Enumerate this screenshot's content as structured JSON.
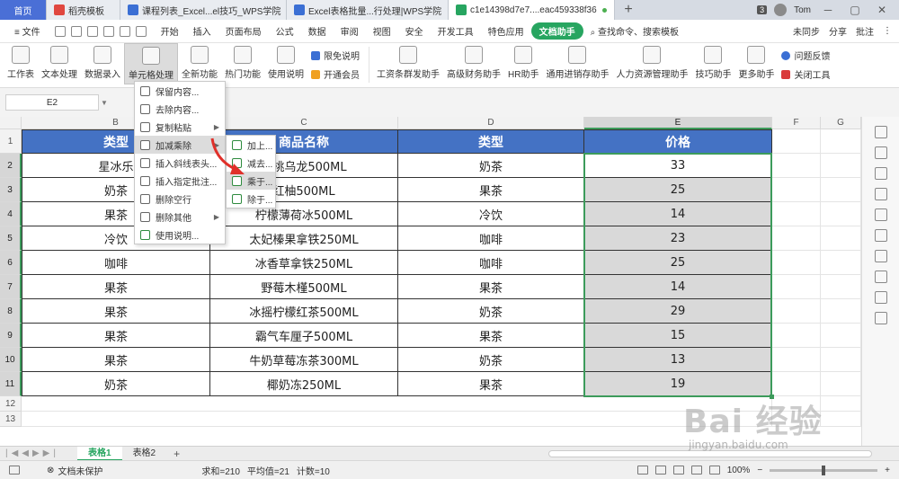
{
  "tabs": {
    "home": "首页",
    "items": [
      "稻壳模板",
      "课程列表_Excel...el技巧_WPS学院",
      "Excel表格批量...行处理|WPS学院",
      "c1e14398d7e7....eac459338f36"
    ],
    "active_index": 3,
    "counter": "3",
    "user": "Tom"
  },
  "menubar": {
    "file": "文件",
    "items": [
      "开始",
      "插入",
      "页面布局",
      "公式",
      "数据",
      "审阅",
      "视图",
      "安全",
      "开发工具",
      "特色应用",
      "文档助手"
    ],
    "active": "文档助手",
    "search": "查找命令、搜索模板",
    "sync": "未同步",
    "share": "分享",
    "comment": "批注"
  },
  "ribbon": {
    "large": [
      "工作表",
      "文本处理",
      "数据录入",
      "单元格处理",
      "全新功能",
      "热门功能",
      "使用说明"
    ],
    "small_col": [
      "限免说明",
      "开通会员"
    ],
    "group2": [
      "工资条群发助手",
      "高级财务助手",
      "HR助手",
      "通用进销存助手",
      "人力资源管理助手",
      "技巧助手",
      "更多助手"
    ],
    "right_col": [
      "问题反馈",
      "关闭工具"
    ]
  },
  "formula_bar": {
    "name_box": "E2"
  },
  "columns": [
    "B",
    "C",
    "D",
    "E",
    "F",
    "G"
  ],
  "rows": [
    "1",
    "2",
    "3",
    "4",
    "5",
    "6",
    "7",
    "8",
    "9",
    "10",
    "11",
    "12",
    "13"
  ],
  "table": {
    "headers": [
      "类型",
      "商品名称",
      "类型",
      "价格"
    ],
    "rows": [
      [
        "星冰乐",
        "蜜桃乌龙500ML",
        "奶茶",
        "33"
      ],
      [
        "奶茶",
        "红柚500ML",
        "果茶",
        "25"
      ],
      [
        "果茶",
        "柠檬薄荷冰500ML",
        "冷饮",
        "14"
      ],
      [
        "冷饮",
        "太妃榛果拿铁250ML",
        "咖啡",
        "23"
      ],
      [
        "咖啡",
        "冰香草拿铁250ML",
        "咖啡",
        "25"
      ],
      [
        "果茶",
        "野莓木槿500ML",
        "果茶",
        "14"
      ],
      [
        "果茶",
        "冰摇柠檬红茶500ML",
        "奶茶",
        "29"
      ],
      [
        "果茶",
        "霸气车厘子500ML",
        "果茶",
        "15"
      ],
      [
        "果茶",
        "牛奶草莓冻茶300ML",
        "奶茶",
        "13"
      ],
      [
        "奶茶",
        "椰奶冻250ML",
        "果茶",
        "19"
      ]
    ]
  },
  "dropdown_main": {
    "items": [
      "保留内容...",
      "去除内容...",
      "复制粘贴",
      "加减乘除",
      "插入斜线表头...",
      "插入指定批注...",
      "删除空行",
      "删除其他",
      "使用说明..."
    ]
  },
  "dropdown_sub": {
    "items": [
      "加上...",
      "减去...",
      "乘于...",
      "除于..."
    ]
  },
  "sheet_tabs": {
    "items": [
      "表格1",
      "表格2"
    ],
    "active": "表格1"
  },
  "statusbar": {
    "protect": "文档未保护",
    "sum": "求和=210",
    "avg": "平均值=21",
    "count": "计数=10",
    "zoom": "100%"
  },
  "watermark": {
    "big": "Bai 经验",
    "small": "jingyan.baidu.com"
  },
  "colors": {
    "header_blue": "#4472c4",
    "accent_green": "#27a560",
    "selection_green": "#3c9b5b"
  }
}
